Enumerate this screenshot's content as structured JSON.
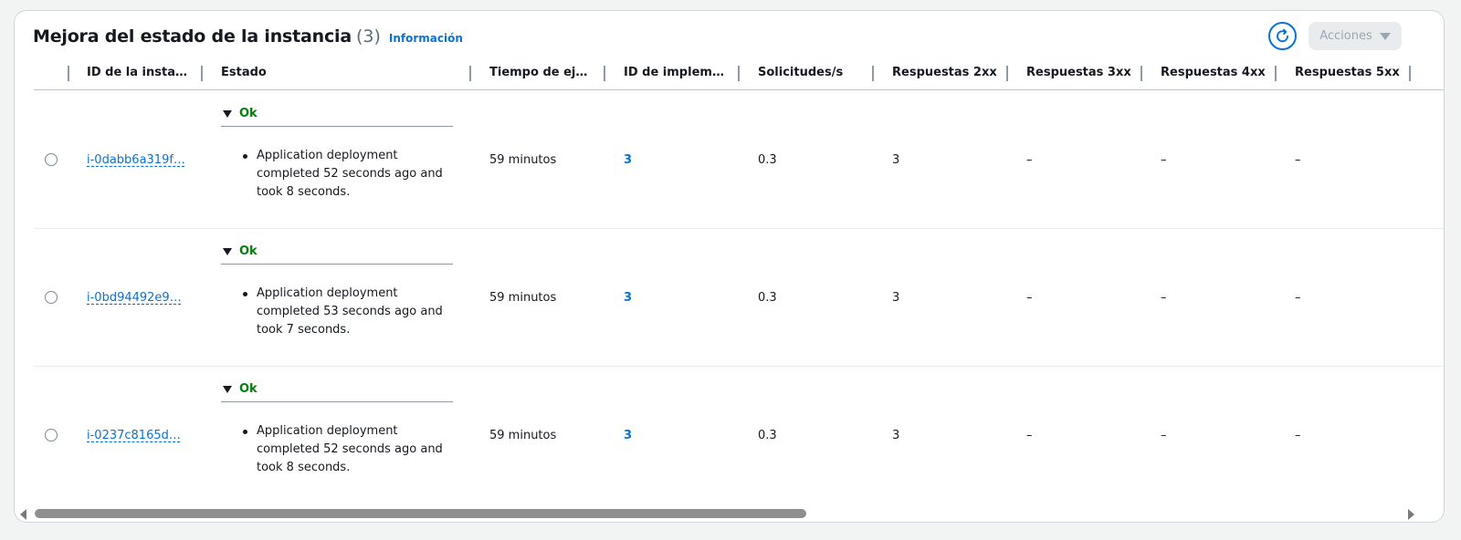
{
  "header": {
    "title": "Mejora del estado de la instancia",
    "count": "(3)",
    "info_link": "Información",
    "actions_label": "Acciones",
    "refresh_icon": "refresh-icon"
  },
  "columns": [
    "ID de la instan…",
    "Estado",
    "Tiempo de eje…",
    "ID de impleme…",
    "Solicitudes/s",
    "Respuestas 2xx",
    "Respuestas 3xx",
    "Respuestas 4xx",
    "Respuestas 5xx"
  ],
  "rows": [
    {
      "instance_id": "i-0dabb6a319f…",
      "status": "Ok",
      "message": "Application deployment completed 52 seconds ago and took 8 seconds.",
      "uptime": "59 minutos",
      "deployment_id": "3",
      "requests": "0.3",
      "r2xx": "3",
      "r3xx": "–",
      "r4xx": "–",
      "r5xx": "–"
    },
    {
      "instance_id": "i-0bd94492e9…",
      "status": "Ok",
      "message": "Application deployment completed 53 seconds ago and took 7 seconds.",
      "uptime": "59 minutos",
      "deployment_id": "3",
      "requests": "0.3",
      "r2xx": "3",
      "r3xx": "–",
      "r4xx": "–",
      "r5xx": "–"
    },
    {
      "instance_id": "i-0237c8165d…",
      "status": "Ok",
      "message": "Application deployment completed 52 seconds ago and took 8 seconds.",
      "uptime": "59 minutos",
      "deployment_id": "3",
      "requests": "0.3",
      "r2xx": "3",
      "r3xx": "–",
      "r4xx": "–",
      "r5xx": "–"
    }
  ],
  "colors": {
    "link": "#0972d3",
    "ok": "#037f0c",
    "disabled_button": "#e9ebed"
  }
}
